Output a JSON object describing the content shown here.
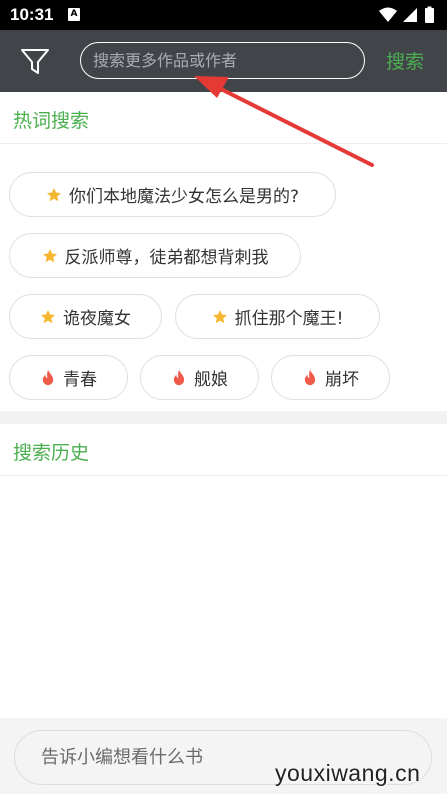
{
  "status_bar": {
    "time": "10:31",
    "notification_glyph": "A"
  },
  "toolbar": {
    "filter_icon": "filter-funnel-icon",
    "search_placeholder": "搜索更多作品或作者",
    "search_button_label": "搜索"
  },
  "hot_search": {
    "title": "热词搜索",
    "items": [
      {
        "label": "你们本地魔法少女怎么是男的?",
        "icon": "star-icon"
      },
      {
        "label": "反派师尊，徒弟都想背刺我",
        "icon": "star-icon"
      },
      {
        "label": "诡夜魔女",
        "icon": "star-icon"
      },
      {
        "label": "抓住那个魔王!",
        "icon": "star-icon"
      },
      {
        "label": "青春",
        "icon": "flame-icon"
      },
      {
        "label": "舰娘",
        "icon": "flame-icon"
      },
      {
        "label": "崩坏",
        "icon": "flame-icon"
      }
    ]
  },
  "history": {
    "title": "搜索历史"
  },
  "feedback": {
    "placeholder": "告诉小编想看什么书"
  },
  "watermark": "youxiwang.cn",
  "colors": {
    "accent_green": "#4caf50",
    "toolbar_bg": "#41454a",
    "star": "#f5b731",
    "flame": "#f05a4a",
    "annotation_arrow": "#e53935"
  }
}
